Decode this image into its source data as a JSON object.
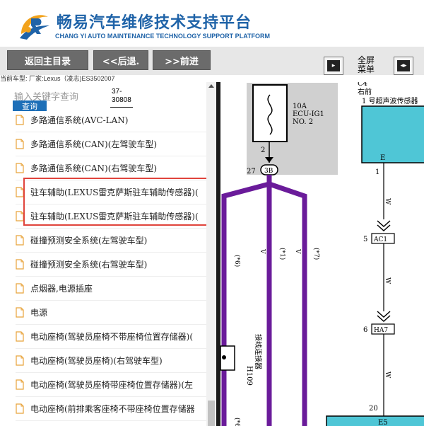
{
  "header": {
    "title_cn": "畅易汽车维修技术支持平台",
    "title_en": "CHANG YI AUTO MAINTENANCE TECHNOLOGY SUPPORT PLATFORM"
  },
  "toolbar": {
    "home_label": "返回主目录",
    "back_label": "<<后退.",
    "forward_label": ">>前进",
    "fullscreen_line1": "全屏",
    "fullscreen_line2": "菜单"
  },
  "vehicle_info": "当前车型:  厂家:Lexus（凌志)ES3502007",
  "search": {
    "placeholder": "输入关键字查询",
    "button_label": "查询"
  },
  "doc_code": {
    "line1": "37-",
    "line2": "30808"
  },
  "menu_items": [
    "多路通信系统(AVC-LAN)",
    "多路通信系统(CAN)(左驾驶车型)",
    "多路通信系统(CAN)(右驾驶车型)",
    "驻车辅助(LEXUS雷克萨斯驻车辅助传感器)(",
    "驻车辅助(LEXUS雷克萨斯驻车辅助传感器)(",
    "碰撞预测安全系统(左驾驶车型)",
    "碰撞预测安全系统(右驾驶车型)",
    "点烟器,电源插座",
    "电源",
    "电动座椅(驾驶员座椅不带座椅位置存储器)(",
    "电动座椅(驾驶员座椅)(右驾驶车型)",
    "电动座椅(驾驶员座椅带座椅位置存储器)(左",
    "电动座椅(前排乘客座椅不带座椅位置存储器"
  ],
  "diagram": {
    "fuse_rating": "10A",
    "fuse_name": "ECU-IG1",
    "fuse_no": "NO. 2",
    "pin_2": "2",
    "pin_27": "27",
    "junction": "3B",
    "c4": "C4",
    "front_right": "右前",
    "sensor_label": "1 号超声波传感器",
    "pin_e": "E",
    "wire_1": "1",
    "wire_5": "5",
    "connector_ac1": "AC1",
    "wire_6": "6",
    "connector_ha7": "HA7",
    "wire_20": "20",
    "connector_e5": "E5",
    "note_6": "(*6)",
    "note_1": "(*1)",
    "note_7": "(*7)",
    "note_6b": "(*6)",
    "wire_v1": "V",
    "wire_v2": "V",
    "wire_w1": "W",
    "wire_w2": "W",
    "wire_w3": "W",
    "h109_code": "H109",
    "h109_name": "接线连接器"
  },
  "colors": {
    "brand_blue": "#1f63a8",
    "toolbar_button": "#6b6b6b",
    "search_button": "#1d6fb8",
    "highlight_box": "#e0443c",
    "wire_purple": "#6a1b9a",
    "fuse_box_gray": "#d0d0d0",
    "connector_cyan": "#4fc6d6"
  }
}
